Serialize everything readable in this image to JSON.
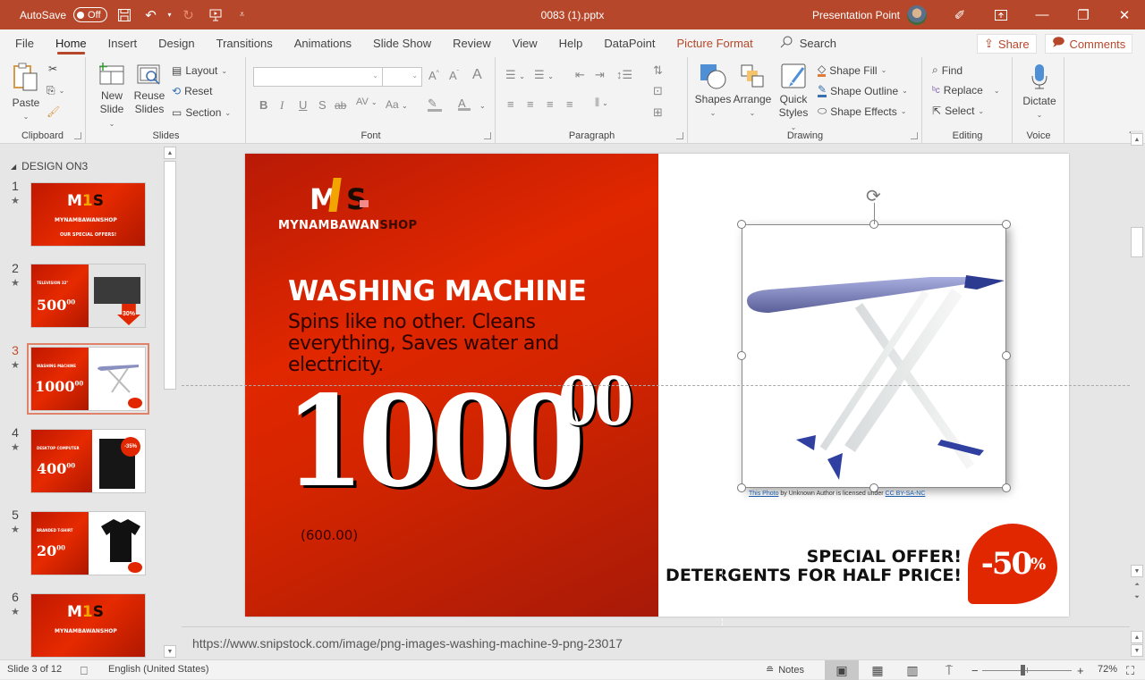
{
  "titlebar": {
    "autosave_label": "AutoSave",
    "autosave_state": "Off",
    "filename": "0083 (1).pptx",
    "user_name": "Presentation Point",
    "quick_access": [
      "save-icon",
      "undo-icon",
      "redo-icon",
      "start-presentation-icon",
      "customize-qat-icon"
    ]
  },
  "menu": {
    "tabs": [
      "File",
      "Home",
      "Insert",
      "Design",
      "Transitions",
      "Animations",
      "Slide Show",
      "Review",
      "View",
      "Help",
      "DataPoint",
      "Picture Format"
    ],
    "active_tab": "Home",
    "contextual_tab": "Picture Format",
    "search_label": "Search",
    "share_label": "Share",
    "comments_label": "Comments"
  },
  "ribbon": {
    "clipboard": {
      "label": "Clipboard",
      "paste": "Paste"
    },
    "slides": {
      "label": "Slides",
      "new_slide_1": "New",
      "new_slide_2": "Slide",
      "reuse_1": "Reuse",
      "reuse_2": "Slides",
      "layout": "Layout",
      "reset": "Reset",
      "section": "Section"
    },
    "font": {
      "label": "Font",
      "font_name": "",
      "font_size": "",
      "bold": "B",
      "italic": "I",
      "underline": "U",
      "shadow": "S",
      "strike": "ab",
      "spacing": "AV",
      "case": "Aa"
    },
    "paragraph": {
      "label": "Paragraph"
    },
    "drawing": {
      "label": "Drawing",
      "shapes": "Shapes",
      "arrange": "Arrange",
      "quick_1": "Quick",
      "quick_2": "Styles",
      "fill": "Shape Fill",
      "outline": "Shape Outline",
      "effects": "Shape Effects"
    },
    "editing": {
      "label": "Editing",
      "find": "Find",
      "replace": "Replace",
      "select": "Select"
    },
    "voice": {
      "label": "Voice",
      "dictate": "Dictate"
    }
  },
  "slide_panel": {
    "section_name": "DESIGN ON3",
    "thumbnails": [
      {
        "number": "1",
        "brand": "MYNAMBAWANSHOP",
        "tagline": "OUR SPECIAL OFFERS!"
      },
      {
        "number": "2",
        "title": "TELEVISION 32\"",
        "price": "500",
        "cents": "00",
        "badge": "30%"
      },
      {
        "number": "3",
        "title": "WASHING MACHINE",
        "price": "1000",
        "cents": "00"
      },
      {
        "number": "4",
        "title": "DESKTOP COMPUTER",
        "price": "400",
        "cents": "00",
        "badge": "-35%"
      },
      {
        "number": "5",
        "title": "BRANDED T-SHIRT",
        "price": "20",
        "cents": "00"
      },
      {
        "number": "6",
        "brand": "MYNAMBAWANSHOP"
      }
    ],
    "selected": 3
  },
  "slide": {
    "logo_text": "M1S",
    "brand_main": "MYNAMBAWAN",
    "brand_accent": "SHOP",
    "title": "WASHING MACHINE",
    "description": "Spins like no other. Cleans everything, Saves water and electricity.",
    "price": "1000",
    "price_cents": "00",
    "old_price": "(600.00)",
    "offer_line1": "SPECIAL OFFER!",
    "offer_line2": "DETERGENTS FOR HALF PRICE!",
    "discount": "-50",
    "discount_unit": "%",
    "caption_link1": "This Photo",
    "caption_mid": " by Unknown Author is licensed under ",
    "caption_link2": "CC BY-SA-NC",
    "colors": {
      "brand_red": "#e02700",
      "title_bar": "#b7472a"
    }
  },
  "notes": {
    "text": "https://www.snipstock.com/image/png-images-washing-machine-9-png-23017"
  },
  "statusbar": {
    "slide_info": "Slide 3 of 12",
    "language": "English (United States)",
    "notes_label": "Notes",
    "zoom_level": "72%",
    "zoom_fraction": 0.45
  }
}
